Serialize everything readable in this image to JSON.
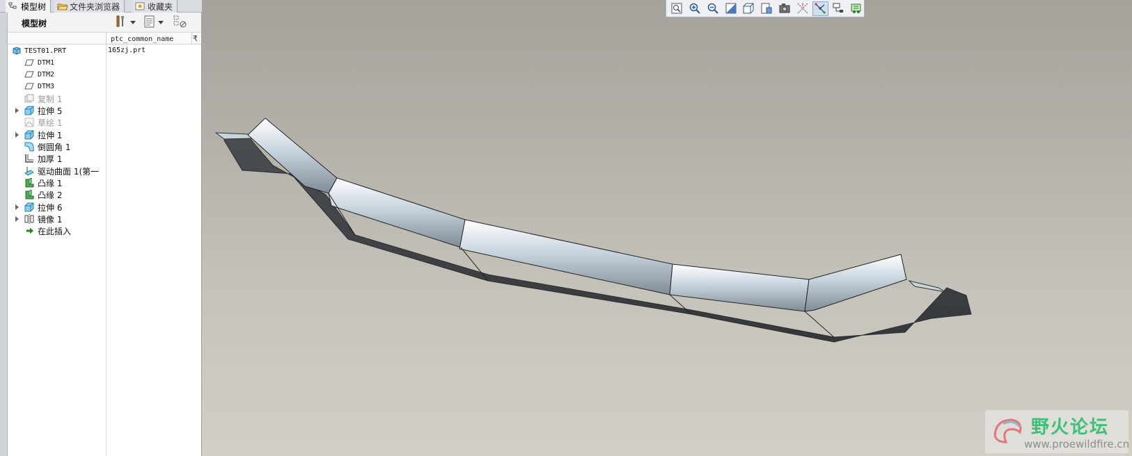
{
  "tabs": [
    {
      "label": "模型树",
      "icon": "model-tree-icon",
      "active": true
    },
    {
      "label": "文件夹浏览器",
      "icon": "folder-icon",
      "active": false
    },
    {
      "label": "收藏夹",
      "icon": "favorites-icon",
      "active": false
    }
  ],
  "model_tree": {
    "title": "模型树",
    "column_header": "ptc_common_name",
    "column_extra": "₹",
    "items": [
      {
        "label": "TEST01.PRT",
        "icon": "part-icon",
        "value": "165zj.prt",
        "expandable": false,
        "dim": false
      },
      {
        "label": "DTM1",
        "icon": "datum-plane-icon",
        "expandable": false,
        "dim": false
      },
      {
        "label": "DTM2",
        "icon": "datum-plane-icon",
        "expandable": false,
        "dim": false
      },
      {
        "label": "DTM3",
        "icon": "datum-plane-icon",
        "expandable": false,
        "dim": false
      },
      {
        "label": "复制 1",
        "icon": "copy-feature-icon",
        "expandable": false,
        "dim": true
      },
      {
        "label": "拉伸 5",
        "icon": "extrude-icon",
        "expandable": true,
        "dim": false
      },
      {
        "label": "草绘 1",
        "icon": "sketch-icon",
        "expandable": false,
        "dim": true
      },
      {
        "label": "拉伸 1",
        "icon": "extrude-icon",
        "expandable": true,
        "dim": false
      },
      {
        "label": "倒圆角 1",
        "icon": "round-icon",
        "expandable": false,
        "dim": false
      },
      {
        "label": "加厚 1",
        "icon": "thicken-icon",
        "expandable": false,
        "dim": false
      },
      {
        "label": "驱动曲面 1(第一",
        "icon": "driven-surface-icon",
        "expandable": false,
        "dim": false
      },
      {
        "label": "凸缘 1",
        "icon": "flange-icon",
        "expandable": false,
        "dim": false
      },
      {
        "label": "凸缘 2",
        "icon": "flange-icon",
        "expandable": false,
        "dim": false
      },
      {
        "label": "拉伸 6",
        "icon": "extrude-icon",
        "expandable": true,
        "dim": false
      },
      {
        "label": "镜像 1",
        "icon": "mirror-icon",
        "expandable": true,
        "dim": false
      },
      {
        "label": "在此插入",
        "icon": "insert-here-arrow-icon",
        "expandable": false,
        "dim": false
      }
    ]
  },
  "view_toolbar": {
    "buttons": [
      {
        "icon": "refit-icon",
        "active": false
      },
      {
        "icon": "zoom-in-icon",
        "active": false
      },
      {
        "icon": "zoom-out-icon",
        "active": false
      },
      {
        "icon": "repaint-icon",
        "active": false
      },
      {
        "icon": "display-style-icon",
        "active": false
      },
      {
        "icon": "saved-views-icon",
        "active": false
      },
      {
        "icon": "view-manager-icon",
        "active": false
      },
      {
        "icon": "datum-display-icon",
        "active": false
      },
      {
        "icon": "spin-center-icon",
        "active": true
      },
      {
        "icon": "annotation-display-icon",
        "active": false
      },
      {
        "icon": "appearance-icon",
        "active": false
      }
    ]
  },
  "colors": {
    "viewport_top": "#a4a29a",
    "viewport_bottom": "#d1cfc6",
    "model_top": "#dfe9f1",
    "model_side": "#3f4347",
    "insert_arrow": "#1e8a1e"
  },
  "watermark": {
    "title": "野火论坛",
    "url": "www.proewildfire.cn"
  }
}
